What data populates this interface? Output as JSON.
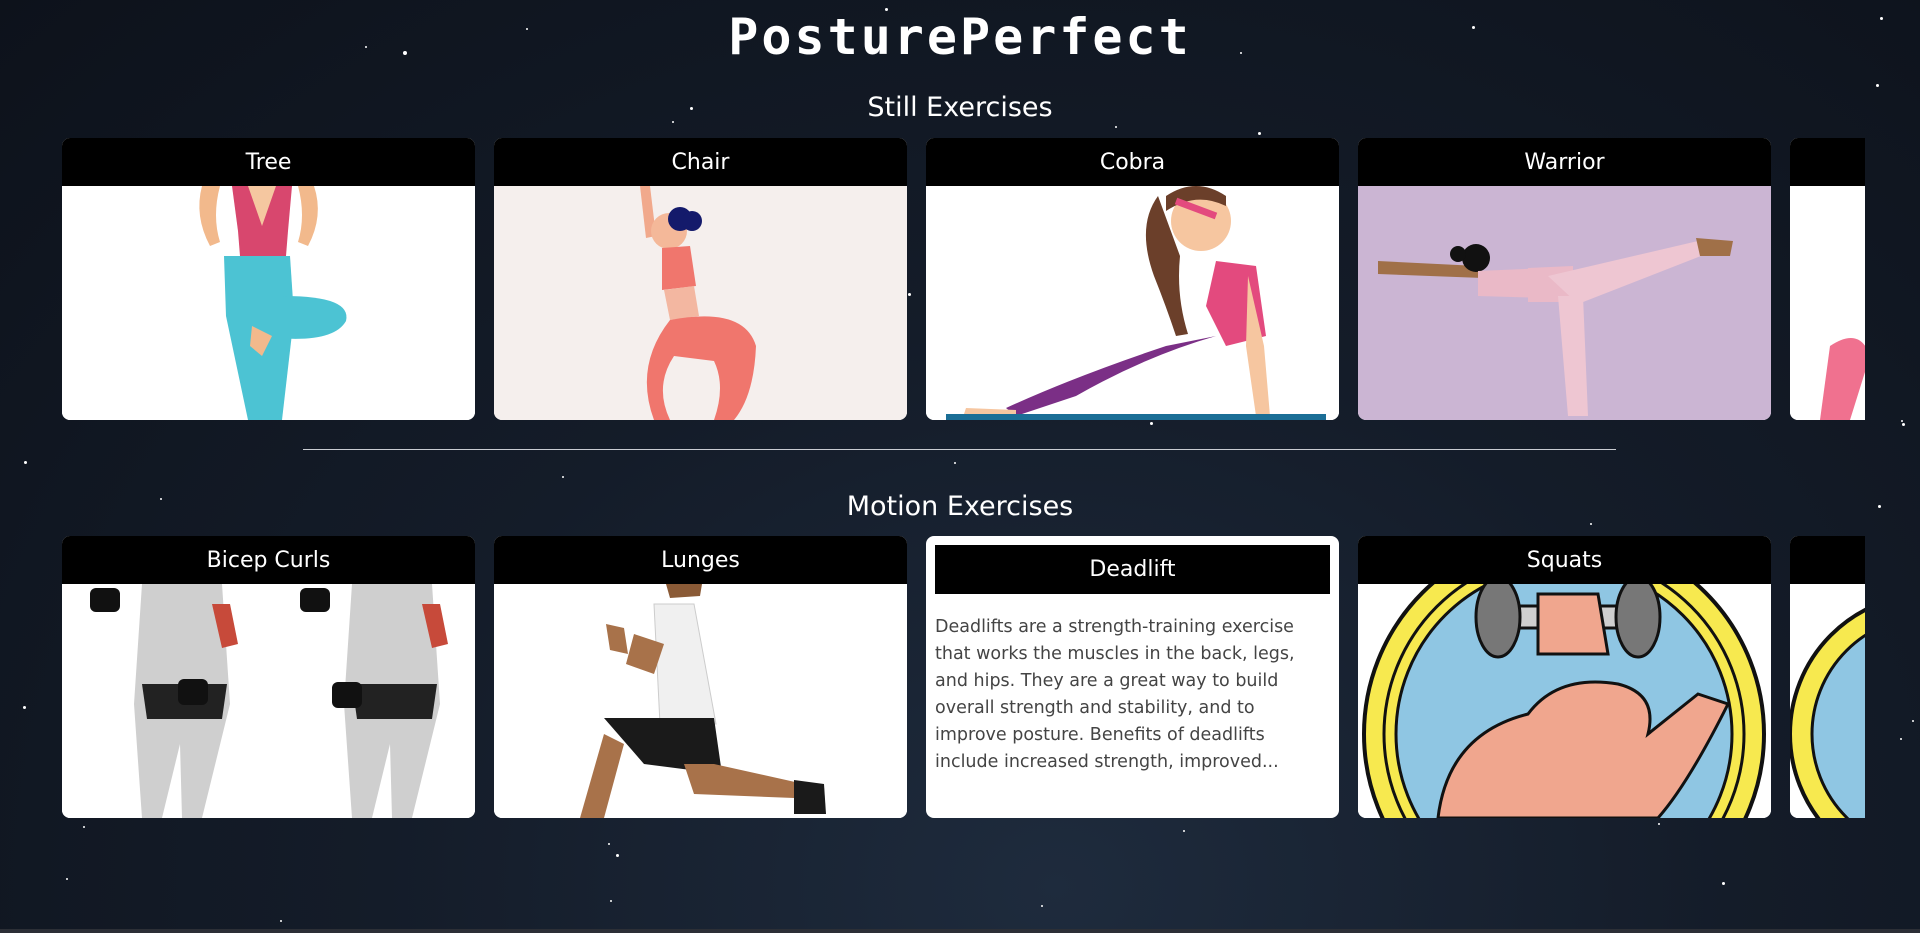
{
  "app": {
    "title": "PosturePerfect"
  },
  "still": {
    "title": "Still Exercises",
    "cards": [
      {
        "label": "Tree",
        "icon": "tree-pose-illustration"
      },
      {
        "label": "Chair",
        "icon": "chair-pose-illustration"
      },
      {
        "label": "Cobra",
        "icon": "cobra-pose-illustration"
      },
      {
        "label": "Warrior",
        "icon": "warrior-pose-illustration"
      }
    ]
  },
  "motion": {
    "title": "Motion Exercises",
    "cards": [
      {
        "label": "Bicep Curls",
        "icon": "bicep-curl-illustration"
      },
      {
        "label": "Lunges",
        "icon": "lunge-illustration"
      },
      {
        "label": "Deadlift",
        "description": "Deadlifts are a strength-training exercise that works the muscles in the back, legs, and hips. They are a great way to build overall strength and stability, and to improve posture. Benefits of deadlifts include increased strength, improved..."
      },
      {
        "label": "Squats",
        "icon": "flexed-arm-dumbbell-illustration"
      }
    ]
  },
  "colors": {
    "background": "#141c29",
    "card_header": "#000000",
    "card": "#ffffff"
  }
}
